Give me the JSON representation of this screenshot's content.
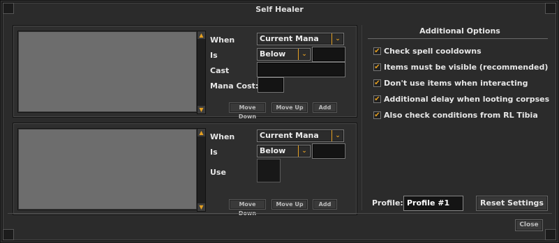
{
  "window": {
    "title": "Self Healer",
    "close_label": "Close"
  },
  "healer_panels": [
    {
      "when_label": "When",
      "when_value": "Current Mana",
      "is_label": "Is",
      "is_value": "Below",
      "action_label": "Cast",
      "extra_label": "Mana Cost:",
      "buttons": {
        "move_down": "Move Down",
        "move_up": "Move Up",
        "add": "Add"
      }
    },
    {
      "when_label": "When",
      "when_value": "Current Mana",
      "is_label": "Is",
      "is_value": "Below",
      "action_label": "Use",
      "buttons": {
        "move_down": "Move Down",
        "move_up": "Move Up",
        "add": "Add"
      }
    }
  ],
  "additional_options": {
    "title": "Additional Options",
    "options": [
      {
        "label": "Check spell cooldowns",
        "checked": true
      },
      {
        "label": "Items must be visible (recommended)",
        "checked": true
      },
      {
        "label": "Don't use items when interacting",
        "checked": true
      },
      {
        "label": "Additional delay when looting corpses",
        "checked": true
      },
      {
        "label": "Also check conditions from RL Tibia",
        "checked": true
      }
    ]
  },
  "profile": {
    "label": "Profile:",
    "value": "Profile #1",
    "reset_label": "Reset Settings"
  },
  "colors": {
    "accent": "#e5a021",
    "list_bg": "#6d6d6d",
    "window_bg": "#2b2b2b"
  },
  "icons": {
    "dropdown": "chevron-down-icon",
    "check": "checkmark-icon",
    "scroll_up": "arrow-up-icon",
    "scroll_down": "arrow-down-icon"
  }
}
